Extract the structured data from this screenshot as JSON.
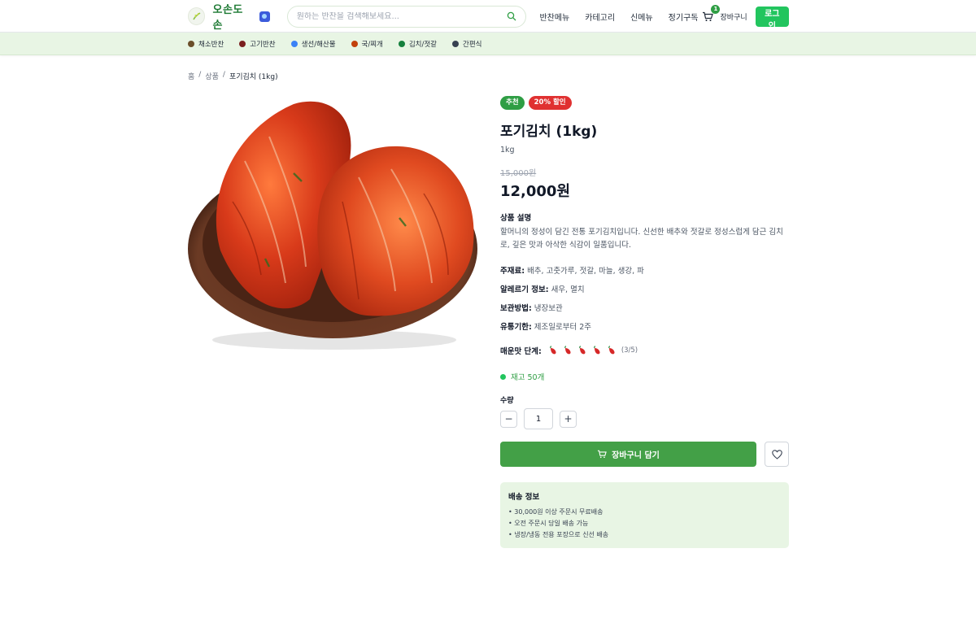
{
  "header": {
    "logo_text": "오손도손",
    "search_placeholder": "원하는 반찬을 검색해보세요...",
    "nav": [
      "반찬메뉴",
      "카테고리",
      "신메뉴",
      "정기구독"
    ],
    "cart_count": "1",
    "cart_label": "장바구니",
    "login_label": "로그인"
  },
  "categories": [
    {
      "label": "채소반찬",
      "color": "#6b4f2a"
    },
    {
      "label": "고기반찬",
      "color": "#7a1f1f"
    },
    {
      "label": "생선/해산물",
      "color": "#3b82f6"
    },
    {
      "label": "국/찌개",
      "color": "#c2410c"
    },
    {
      "label": "김치/젓갈",
      "color": "#15803d"
    },
    {
      "label": "간편식",
      "color": "#374151"
    }
  ],
  "breadcrumb": {
    "home": "홈",
    "sep": "/",
    "products": "상품",
    "current": "포기김치 (1kg)"
  },
  "product": {
    "badges": [
      "추천",
      "20% 할인"
    ],
    "title": "포기김치 (1kg)",
    "weight": "1kg",
    "original_price": "15,000원",
    "price": "12,000원",
    "desc_heading": "상품 설명",
    "description": "할머니의 정성이 담긴 전통 포기김치입니다. 신선한 배추와 젓갈로 정성스럽게 담근 김치로, 깊은 맛과 아삭한 식감이 일품입니다.",
    "ingredients_label": "주재료:",
    "ingredients": "배추, 고춧가루, 젓갈, 마늘, 생강, 파",
    "allergy_label": "알레르기 정보:",
    "allergy": "새우, 멸치",
    "storage_label": "보관방법:",
    "storage": "냉장보관",
    "expiry_label": "유통기한:",
    "expiry": "제조일로부터 2주",
    "spicy_label": "매운맛 단계:",
    "spicy_level": 3,
    "spicy_max": 5,
    "spicy_text": "(3/5)",
    "stock": "재고 50개",
    "qty_label": "수량",
    "qty": "1",
    "add_to_cart": "장바구니 담기"
  },
  "shipping": {
    "heading": "배송 정보",
    "items": [
      "30,000원 이상 주문시 무료배송",
      "오전 주문시 당일 배송 가능",
      "냉장/냉동 전용 포장으로 신선 배송"
    ]
  }
}
